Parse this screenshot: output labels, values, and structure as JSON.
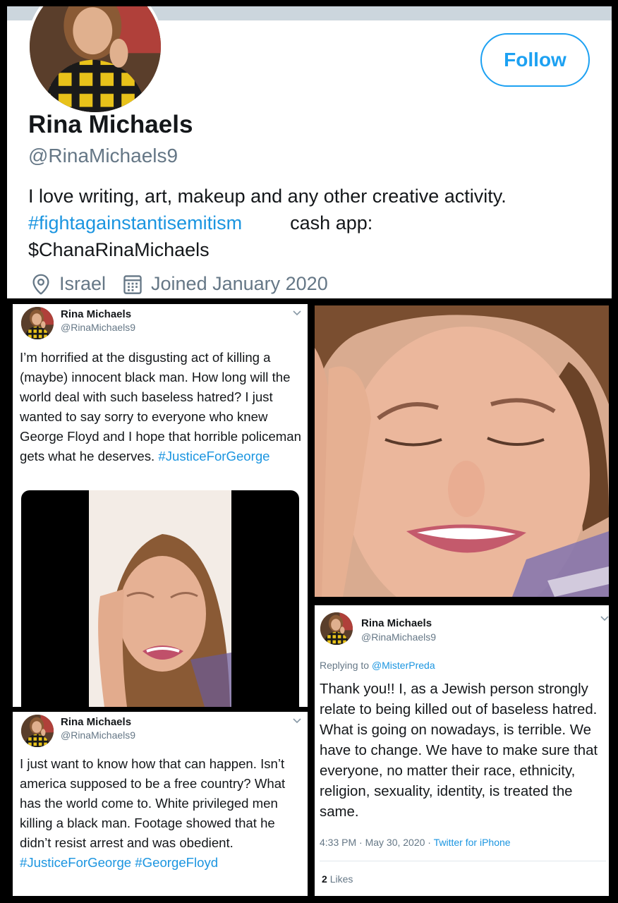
{
  "profile": {
    "name": "Rina Michaels",
    "handle": "@RinaMichaels9",
    "follow_label": "Follow",
    "bio_line1": "I love writing, art, makeup and any other creative activity.",
    "bio_hashtag": "#fightagainstantisemitism",
    "bio_cashapp": "cash app:",
    "bio_line3": "$ChanaRinaMichaels",
    "location": "Israel",
    "joined": "Joined January 2020",
    "icons": {
      "location": "location-pin-icon",
      "calendar": "calendar-icon"
    }
  },
  "tweet1": {
    "name": "Rina Michaels",
    "handle": "@RinaMichaels9",
    "text": "I’m horrified at the disgusting act of killing a (maybe) innocent black man. How long will the world deal with such baseless hatred? I just wanted to say sorry to everyone who knew George Floyd and I hope that horrible policeman gets what he deserves.",
    "hashtag": "#JusticeForGeorge"
  },
  "tweet2": {
    "name": "Rina Michaels",
    "handle": "@RinaMichaels9",
    "text": "I just want to know how that can happen. Isn’t america supposed to be a free country? What has the world come to. White privileged men killing a black man. Footage showed that he didn’t resist arrest and was obedient.",
    "hashtag1": "#JusticeForGeorge",
    "hashtag2": "#GeorgeFloyd"
  },
  "tweet3": {
    "name": "Rina Michaels",
    "handle": "@RinaMichaels9",
    "replying_label": "Replying to",
    "replying_to": "@MisterPreda",
    "text": "Thank you!! I, as a Jewish person strongly relate to being killed out of baseless hatred. What is going on nowadays, is terrible. We have to change. We have to make sure that everyone, no matter their race, ethnicity, religion, sexuality, identity, is treated the same.",
    "time": "4:33 PM · May 30, 2020 ·",
    "source": "Twitter for iPhone",
    "likes_count": "2",
    "likes_label": "Likes"
  },
  "colors": {
    "accent": "#1da1f2",
    "link": "#1b95e0",
    "secondary_text": "#657786",
    "primary_text": "#14171a"
  }
}
